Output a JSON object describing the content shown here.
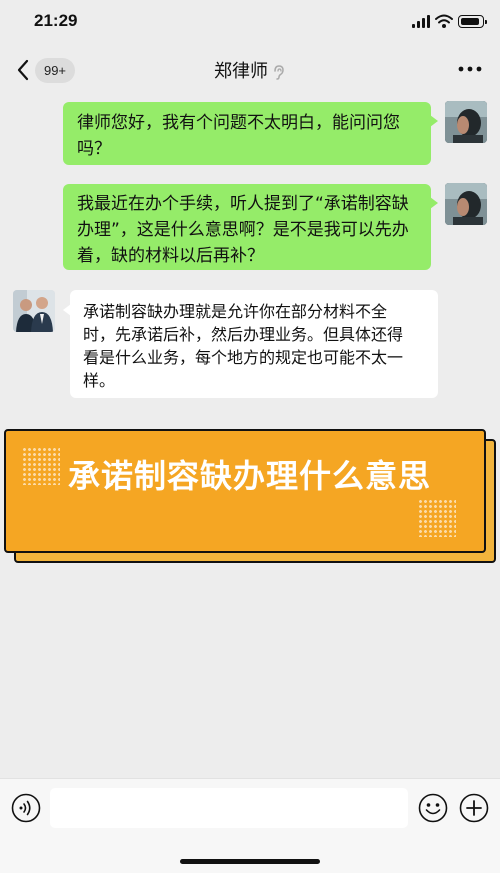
{
  "status_bar": {
    "time": "21:29"
  },
  "nav": {
    "unread_badge": "99+",
    "title": "郑律师"
  },
  "messages": [
    {
      "side": "right",
      "lines": [
        "律师您好，我有个问题不太明白，能问问您",
        "吗？"
      ]
    },
    {
      "side": "right",
      "lines": [
        "我最近在办个手续，听人提到了“承诺制容缺",
        "办理”，这是什么意思啊？是不是我可以先办",
        "着，缺的材料以后再补？"
      ]
    },
    {
      "side": "left",
      "lines": [
        "承诺制容缺办理就是允许你在部分材料不全",
        "时，先承诺后补，然后办理业务。但具体还得",
        "看是什么业务，每个地方的规定也可能不太一",
        "样。"
      ]
    }
  ],
  "banner": {
    "title": "承诺制容缺办理什么意思"
  },
  "colors": {
    "bubble_green": "#95ec69",
    "banner_orange": "#f5a623",
    "background": "#ededed"
  }
}
